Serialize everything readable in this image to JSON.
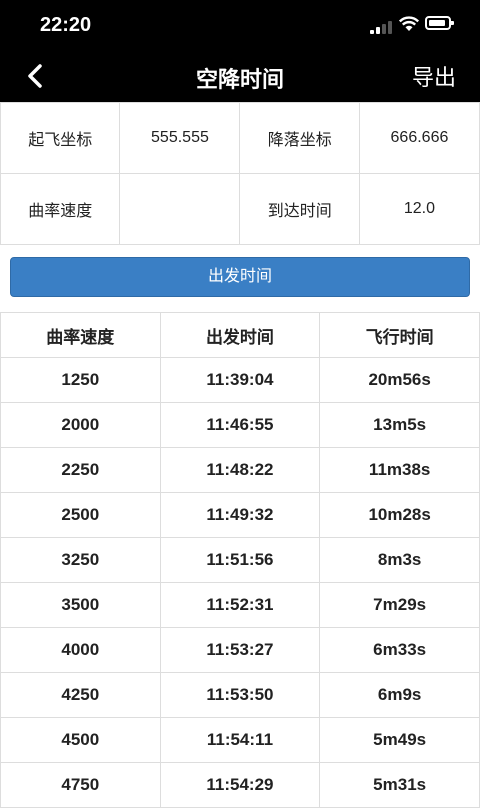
{
  "status": {
    "time": "22:20"
  },
  "header": {
    "title": "空降时间",
    "export_label": "导出"
  },
  "info": {
    "takeoff_label": "起飞坐标",
    "takeoff_value": "555.555",
    "landing_label": "降落坐标",
    "landing_value": "666.666",
    "curve_label": "曲率速度",
    "curve_value": "",
    "arrival_label": "到达时间",
    "arrival_value": "12.0"
  },
  "action_button": "出发时间",
  "table": {
    "headers": [
      "曲率速度",
      "出发时间",
      "飞行时间"
    ],
    "rows": [
      [
        "1250",
        "11:39:04",
        "20m56s"
      ],
      [
        "2000",
        "11:46:55",
        "13m5s"
      ],
      [
        "2250",
        "11:48:22",
        "11m38s"
      ],
      [
        "2500",
        "11:49:32",
        "10m28s"
      ],
      [
        "3250",
        "11:51:56",
        "8m3s"
      ],
      [
        "3500",
        "11:52:31",
        "7m29s"
      ],
      [
        "4000",
        "11:53:27",
        "6m33s"
      ],
      [
        "4250",
        "11:53:50",
        "6m9s"
      ],
      [
        "4500",
        "11:54:11",
        "5m49s"
      ],
      [
        "4750",
        "11:54:29",
        "5m31s"
      ]
    ]
  }
}
